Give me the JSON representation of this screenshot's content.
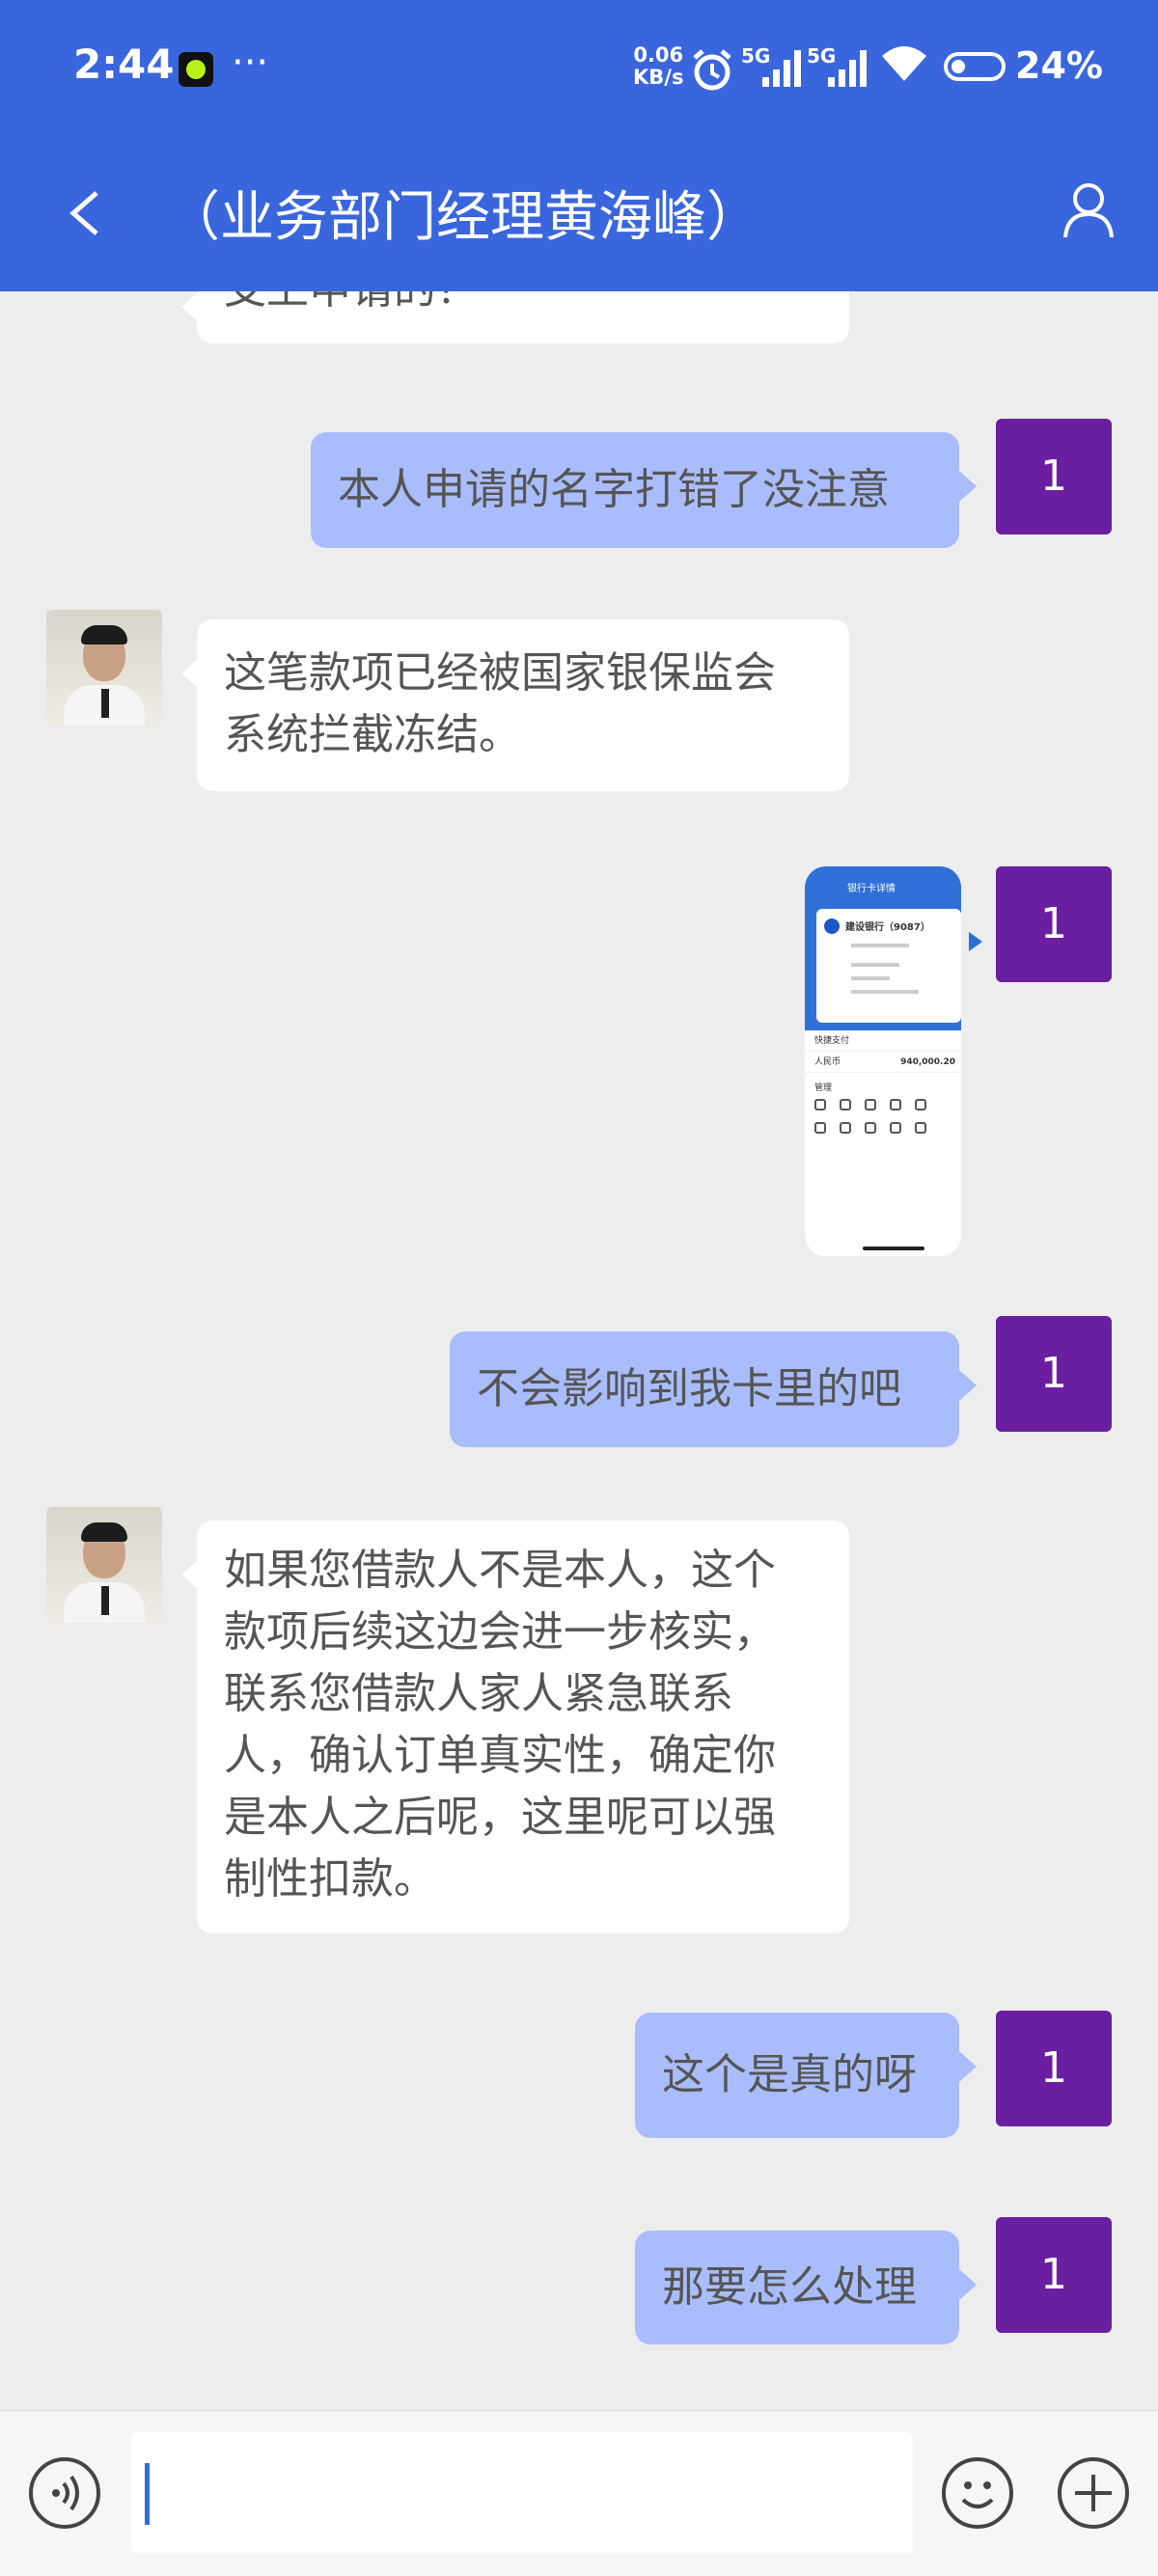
{
  "status_bar": {
    "time": "2:44",
    "more": "···",
    "net_speed_value": "0.06",
    "net_speed_unit": "KB/s",
    "signal1_label": "5G",
    "signal2_label": "5G",
    "battery": "24%"
  },
  "header": {
    "title": "（业务部门经理黄海峰）",
    "back_icon": "chevron-left-icon",
    "profile_icon": "person-icon",
    "color": "#3a66dd"
  },
  "messages": [
    {
      "side": "in",
      "text": "支上申请的？",
      "partial": true
    },
    {
      "side": "out",
      "text": "本人申请的名字打错了没注意",
      "avatar": "1"
    },
    {
      "side": "in",
      "lines": [
        "这笔款项已经被国家银保监会",
        "系统拦截冻结。"
      ]
    },
    {
      "side": "out",
      "type": "image",
      "avatar": "1",
      "image": {
        "title": "银行卡详情",
        "bank": "建设银行（9087）",
        "section1": "快捷支付",
        "label_amount": "人民币",
        "amount": "940,000.20",
        "section2": "管理"
      }
    },
    {
      "side": "out",
      "text": "不会影响到我卡里的吧",
      "avatar": "1"
    },
    {
      "side": "in",
      "lines": [
        "如果您借款人不是本人，这个",
        "款项后续这边会进一步核实，",
        "联系您借款人家人紧急联系",
        "人，确认订单真实性，确定你",
        "是本人之后呢，这里呢可以强",
        "制性扣款。"
      ]
    },
    {
      "side": "out",
      "text": "这个是真的呀",
      "avatar": "1"
    },
    {
      "side": "out",
      "text": "那要怎么处理",
      "avatar": "1"
    }
  ],
  "input_bar": {
    "value": "",
    "voice_icon": "voice-icon",
    "emoji_icon": "emoji-icon",
    "plus_icon": "plus-icon"
  },
  "colors": {
    "self_avatar": "#6a1fa0",
    "out_bubble": "#a9bdfd",
    "in_bubble": "#ffffff",
    "background": "#ededed"
  }
}
